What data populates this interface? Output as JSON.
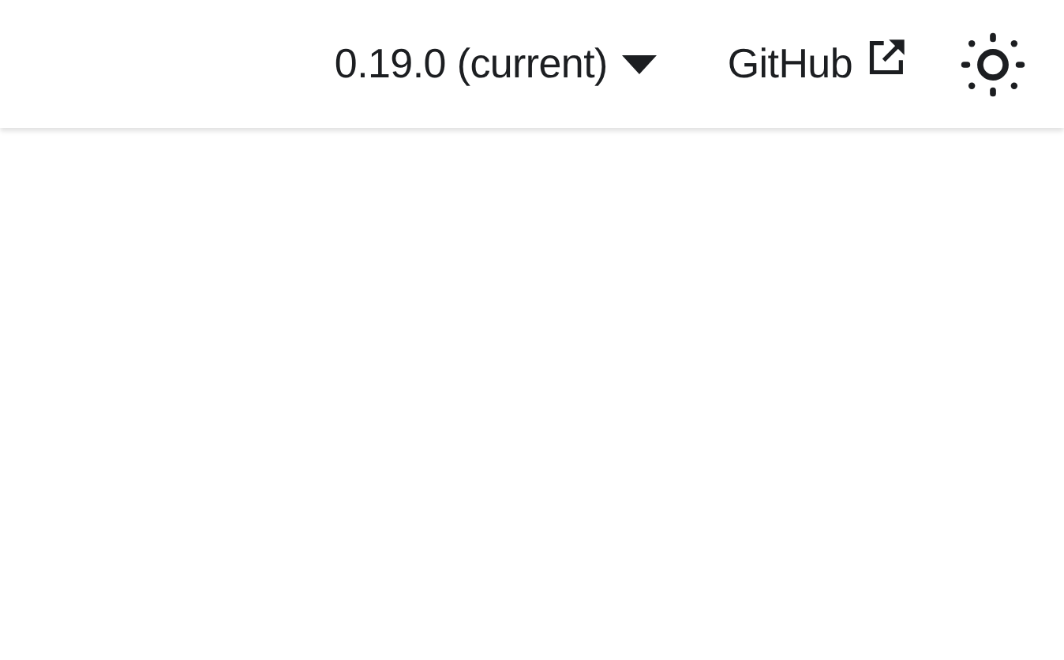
{
  "navbar": {
    "version_menu": {
      "label": "0.19.0 (current)",
      "expanded": false
    },
    "github_link": {
      "label": "GitHub"
    }
  }
}
